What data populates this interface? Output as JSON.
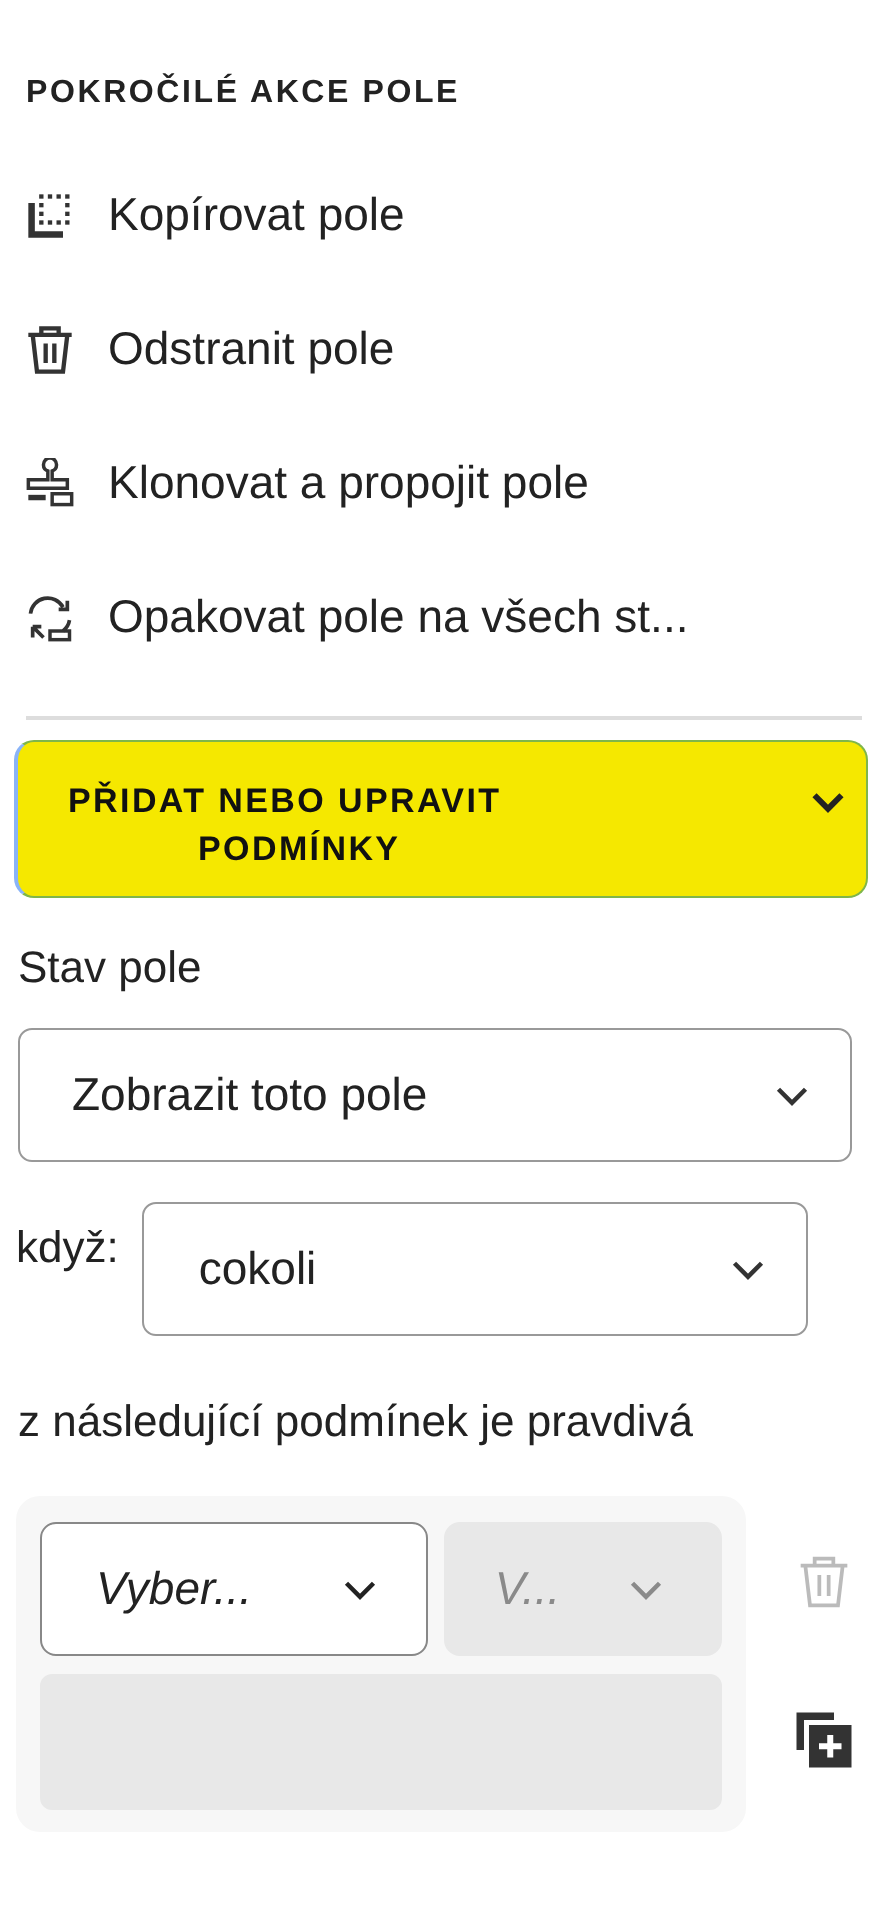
{
  "heading": "POKROČILÉ AKCE POLE",
  "actions": [
    {
      "kind": "copy",
      "label": "Kopírovat pole"
    },
    {
      "kind": "delete",
      "label": "Odstranit pole"
    },
    {
      "kind": "clone",
      "label": "Klonovat a propojit pole"
    },
    {
      "kind": "repeat",
      "label": "Opakovat pole na všech st..."
    }
  ],
  "conditions_section": {
    "title_line1": "PŘIDAT NEBO UPRAVIT",
    "title_line2": "PODMÍNKY",
    "expanded": true
  },
  "state_label": "Stav pole",
  "state_select": {
    "value": "Zobrazit toto pole"
  },
  "when_label": "když:",
  "when_select": {
    "value": "cokoli"
  },
  "condition_text": "z následující podmínek je pravdivá",
  "condition": {
    "field_select": {
      "value": "Vyber...",
      "disabled": false
    },
    "operator_select": {
      "value": "V...",
      "disabled": true
    },
    "value_field": {
      "disabled": true
    },
    "delete_disabled": true
  }
}
